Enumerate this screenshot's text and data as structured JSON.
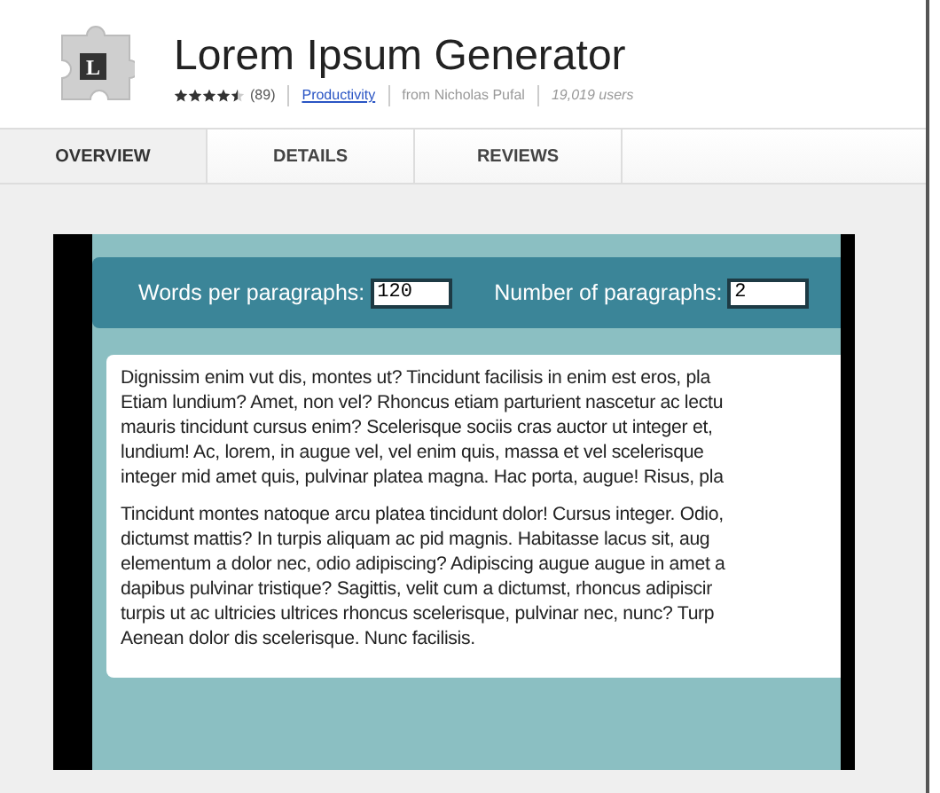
{
  "extension": {
    "icon_letter": "L",
    "title": "Lorem Ipsum Generator",
    "stars": 4.5,
    "rating_count": "(89)",
    "category": "Productivity",
    "author": "from  Nicholas Pufal",
    "users": "19,019 users"
  },
  "tabs": [
    {
      "label": "OVERVIEW",
      "selected": true
    },
    {
      "label": "DETAILS",
      "selected": false
    },
    {
      "label": "REVIEWS",
      "selected": false
    }
  ],
  "screenshot": {
    "fields": [
      {
        "label": "Words per paragraphs:",
        "value": "120"
      },
      {
        "label": "Number of paragraphs:",
        "value": "2"
      }
    ],
    "paragraphs": [
      [
        "Dignissim enim vut dis, montes ut? Tincidunt facilisis in enim est eros, pla",
        "Etiam lundium? Amet, non vel? Rhoncus etiam parturient nascetur ac lectu",
        "mauris tincidunt cursus enim? Scelerisque sociis cras auctor ut integer et,",
        "lundium! Ac, lorem, in augue vel, vel enim quis, massa et vel scelerisque",
        "integer mid amet quis, pulvinar platea magna. Hac porta, augue! Risus, pla"
      ],
      [
        "Tincidunt montes natoque arcu platea tincidunt dolor! Cursus integer. Odio,",
        "dictumst mattis? In turpis aliquam ac pid magnis. Habitasse lacus sit, aug",
        "elementum a dolor nec, odio adipiscing? Adipiscing augue augue in amet a",
        "dapibus pulvinar tristique? Sagittis, velit cum a dictumst, rhoncus adipiscir",
        "turpis ut ac ultricies ultrices rhoncus scelerisque, pulvinar nec, nunc? Turp",
        "Aenean dolor dis scelerisque. Nunc facilisis."
      ]
    ]
  }
}
